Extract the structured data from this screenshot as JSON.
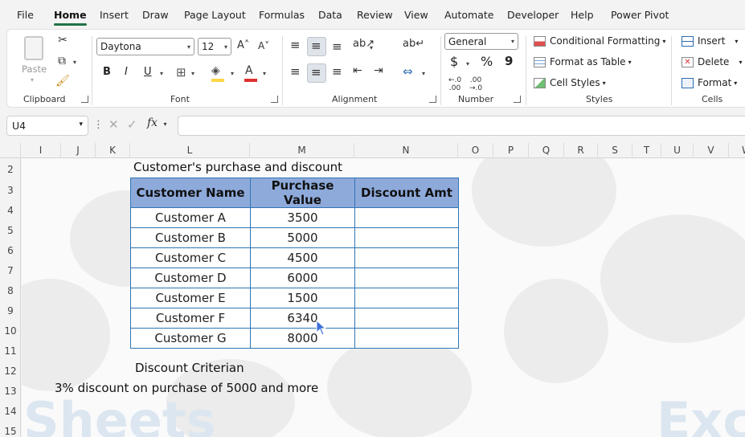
{
  "menu": [
    "File",
    "Home",
    "Insert",
    "Draw",
    "Page Layout",
    "Formulas",
    "Data",
    "Review",
    "View",
    "Automate",
    "Developer",
    "Help",
    "Power Pivot"
  ],
  "ribbon": {
    "clipboard": {
      "paste": "Paste",
      "label": "Clipboard"
    },
    "font": {
      "family": "Daytona",
      "size": "12",
      "label": "Font",
      "bold": "B",
      "italic": "I",
      "underline": "U"
    },
    "alignment": {
      "label": "Alignment"
    },
    "number": {
      "format": "General",
      "currency": "$",
      "percent": "%",
      "comma": "9",
      "label": "Number"
    },
    "styles": {
      "conditional": "Conditional Formatting",
      "format_table": "Format as Table",
      "cell_styles": "Cell Styles",
      "label": "Styles"
    },
    "cells": {
      "insert": "Insert",
      "delete": "Delete",
      "format": "Format",
      "label": "Cells"
    }
  },
  "formula_bar": {
    "name_box": "U4",
    "fx": "fx",
    "value": ""
  },
  "columns": [
    "I",
    "J",
    "K",
    "L",
    "M",
    "N",
    "O",
    "P",
    "Q",
    "R",
    "S",
    "T",
    "U",
    "V",
    "W"
  ],
  "rows": [
    "2",
    "3",
    "4",
    "5",
    "6",
    "7",
    "8",
    "9",
    "10",
    "11",
    "12",
    "13",
    "14",
    "15"
  ],
  "sheet": {
    "title": "Customer's purchase and discount",
    "headers": [
      "Customer Name",
      "Purchase Value",
      "Discount Amt"
    ],
    "data": [
      [
        "Customer A",
        "3500",
        ""
      ],
      [
        "Customer B",
        "5000",
        ""
      ],
      [
        "Customer C",
        "4500",
        ""
      ],
      [
        "Customer D",
        "6000",
        ""
      ],
      [
        "Customer E",
        "1500",
        ""
      ],
      [
        "Customer F",
        "6340",
        ""
      ],
      [
        "Customer G",
        "8000",
        ""
      ]
    ],
    "criterion_title": "Discount Criterian",
    "criterion_text": "3% discount on purchase of 5000 and more"
  },
  "watermarks": [
    "Sheets",
    "Exc"
  ],
  "colors": {
    "accent": "#217346",
    "header_fill": "#8eaadb",
    "table_border": "#2e75b6",
    "font_color_bar": "#e03030",
    "fill_color_bar": "#ffd54a"
  }
}
